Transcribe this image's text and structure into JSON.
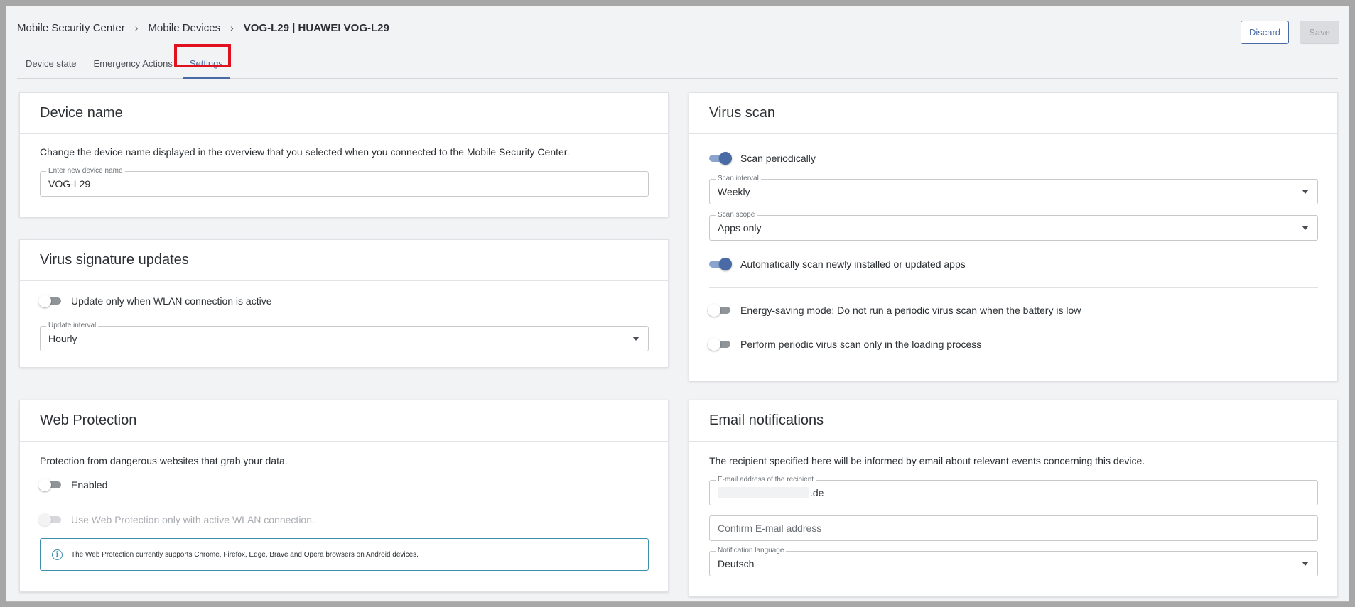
{
  "breadcrumb": {
    "items": [
      "Mobile Security Center",
      "Mobile Devices",
      "VOG-L29 | HUAWEI VOG-L29"
    ]
  },
  "tabs": [
    {
      "label": "Device state",
      "active": false
    },
    {
      "label": "Emergency Actions",
      "active": false
    },
    {
      "label": "Settings",
      "active": true
    }
  ],
  "actions": {
    "discard_label": "Discard",
    "save_label": "Save",
    "save_enabled": false
  },
  "device_name": {
    "title": "Device name",
    "description": "Change the device name displayed in the overview that you selected when you connected to the Mobile Security Center.",
    "input_label": "Enter new device name",
    "input_value": "VOG-L29"
  },
  "virus_signature_updates": {
    "title": "Virus signature updates",
    "wlan_only_label": "Update only when WLAN connection is active",
    "wlan_only_on": false,
    "interval_label": "Update interval",
    "interval_value": "Hourly"
  },
  "web_protection": {
    "title": "Web Protection",
    "description": "Protection from dangerous websites that grab your data.",
    "enabled_label": "Enabled",
    "enabled_on": false,
    "wlan_only_label": "Use Web Protection only with active WLAN connection.",
    "wlan_only_disabled": true,
    "info_text": "The Web Protection currently supports Chrome, Firefox, Edge, Brave and Opera browsers on Android devices."
  },
  "virus_scan": {
    "title": "Virus scan",
    "scan_periodically_label": "Scan periodically",
    "scan_periodically_on": true,
    "interval_label": "Scan interval",
    "interval_value": "Weekly",
    "scope_label": "Scan scope",
    "scope_value": "Apps only",
    "auto_scan_label": "Automatically scan newly installed or updated apps",
    "auto_scan_on": true,
    "energy_saving_label": "Energy-saving mode: Do not run a periodic virus scan when the battery is low",
    "energy_saving_on": false,
    "loading_only_label": "Perform periodic virus scan only in the loading process",
    "loading_only_on": false
  },
  "email_notifications": {
    "title": "Email notifications",
    "description": "The recipient specified here will be informed by email about relevant events concerning this device.",
    "email_label": "E-mail address of the recipient",
    "email_value_visible": ".de",
    "confirm_placeholder": "Confirm E-mail address",
    "language_label": "Notification language",
    "language_value": "Deutsch"
  },
  "colors": {
    "accent": "#4a6aa5",
    "highlight": "#e0101d",
    "info": "#3e8fb0",
    "background": "#f2f3f5"
  },
  "icons": [
    "chevron-right-icon",
    "chevron-down-icon",
    "info-icon"
  ]
}
